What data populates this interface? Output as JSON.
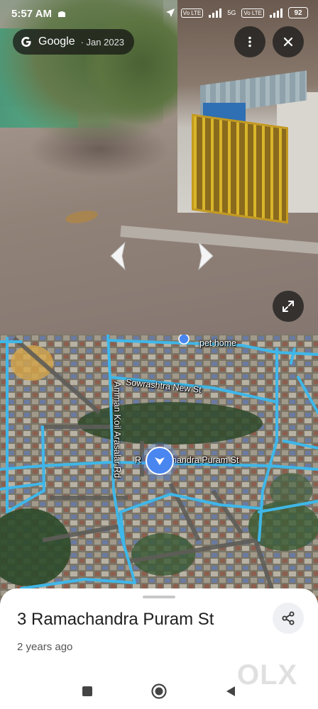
{
  "status_bar": {
    "time": "5:57 AM",
    "battery": "92",
    "network_1": "Vo LTE",
    "network_2": "Vo LTE",
    "network_gen": "5G"
  },
  "street_view": {
    "attribution_brand": "Google",
    "attribution_date": "· Jan 2023",
    "icons": [
      "google-g-icon",
      "more-vert-icon",
      "close-icon",
      "chevron-left-icon",
      "chevron-right-icon",
      "fullscreen-icon"
    ]
  },
  "map": {
    "labels": {
      "pet_home": "pet home",
      "sowrashtra": "Sowrashtra New St",
      "amman_koil": "Amman Koil Arasalar Rd",
      "ramachandra_prefix": "R",
      "ramachandra": "handra Puram St"
    },
    "road_color": "#3fb7e8"
  },
  "place": {
    "title": "3 Ramachandra Puram St",
    "age": "2 years ago",
    "watermark": "OLX"
  },
  "colors": {
    "pin": "#4a86f0",
    "road": "#3fb7e8",
    "sheet_bg": "#ffffff"
  }
}
